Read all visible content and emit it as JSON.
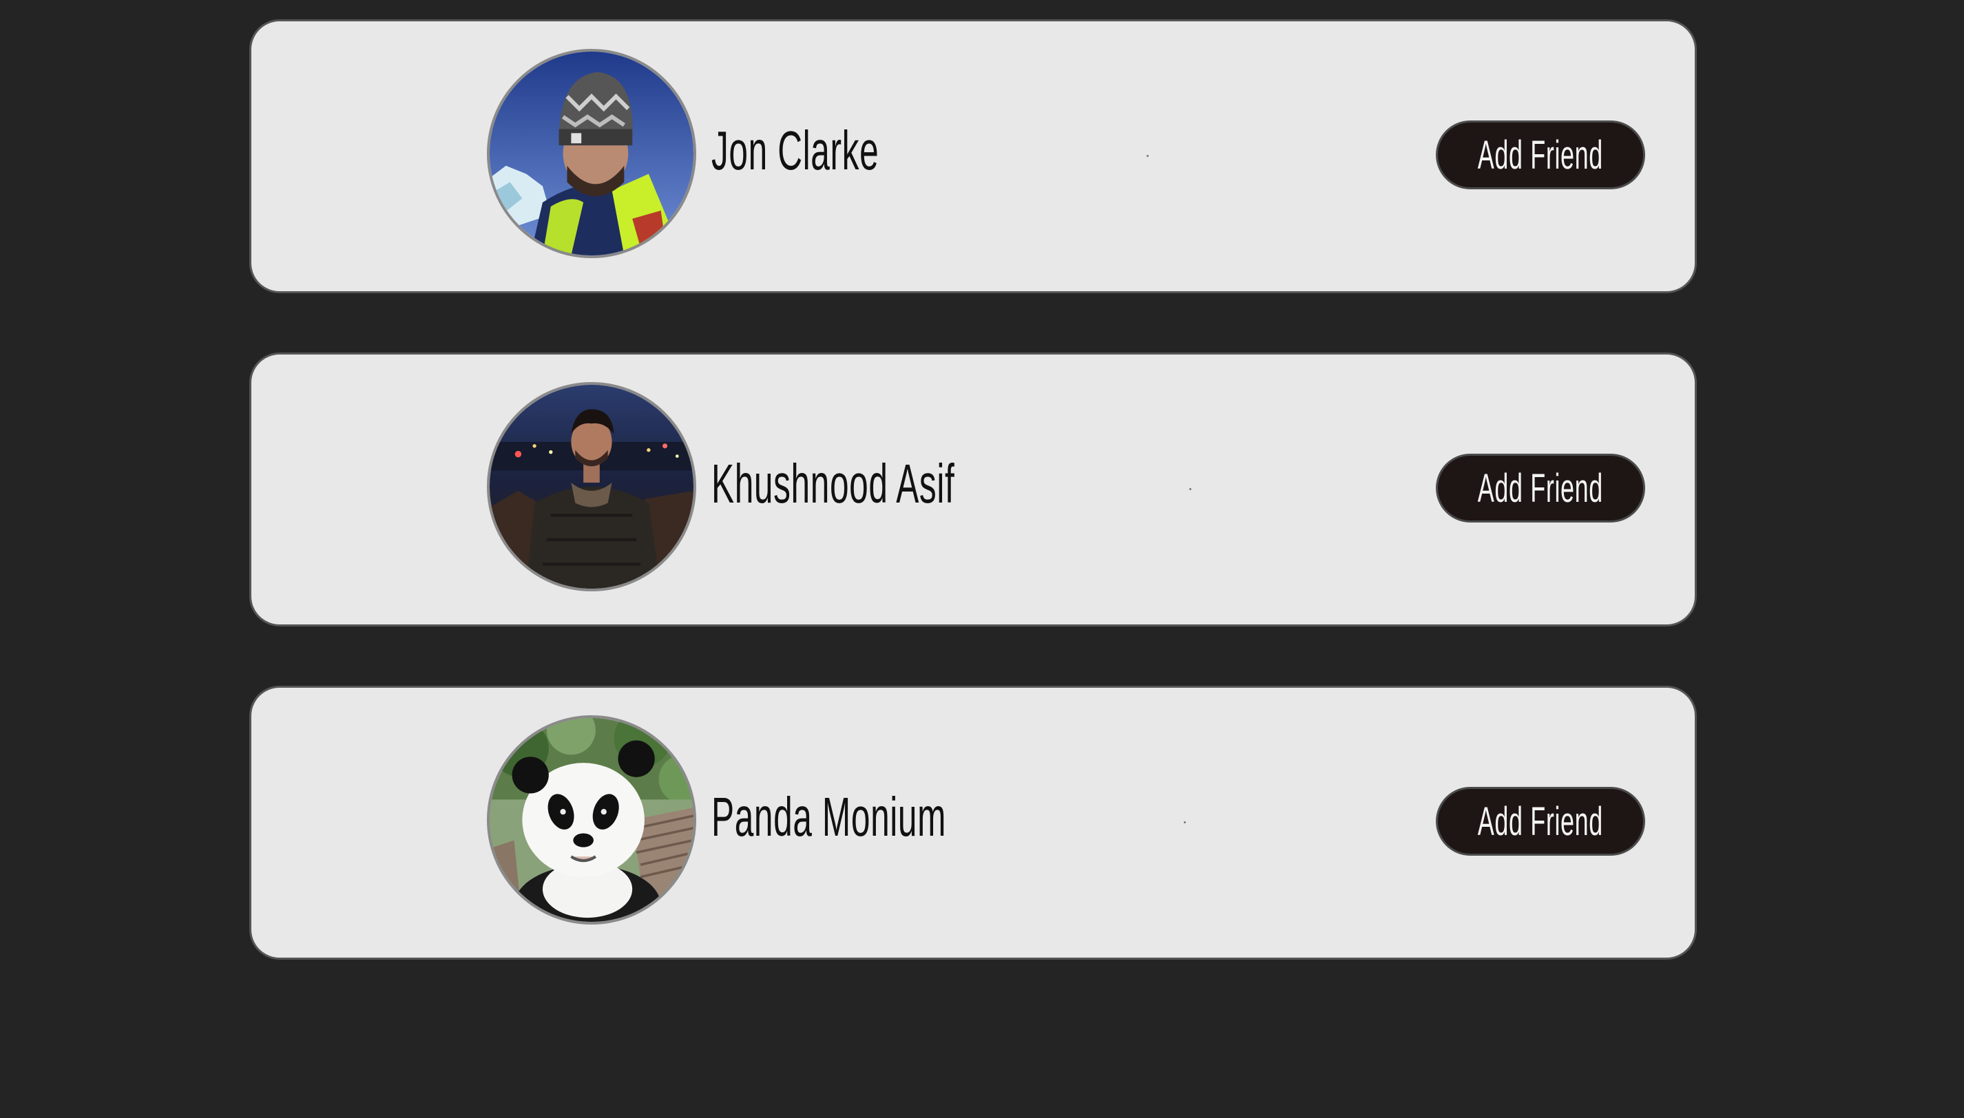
{
  "friends": [
    {
      "name": "Jon Clarke",
      "avatar_icon": "person-winter-hat-photo",
      "button_label": "Add Friend"
    },
    {
      "name": "Khushnood Asif",
      "avatar_icon": "person-city-night-photo",
      "button_label": "Add Friend"
    },
    {
      "name": "Panda Monium",
      "avatar_icon": "panda-photo",
      "button_label": "Add Friend"
    }
  ],
  "colors": {
    "page_background": "#242424",
    "card_background": "#e8e8e8",
    "button_background": "#1e1614",
    "button_text": "#f4f4f4",
    "name_text": "#111111"
  }
}
